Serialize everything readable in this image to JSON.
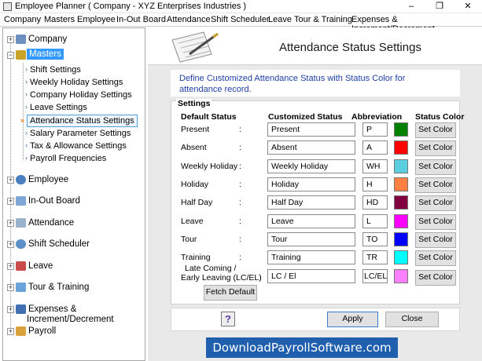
{
  "window": {
    "title": "Employee Planner ( Company - XYZ Enterprises Industries )",
    "minimize": "–",
    "restore": "❐",
    "close": "✕"
  },
  "menu": [
    "Company",
    "Masters",
    "Employee",
    "In-Out Board",
    "Attendance",
    "Shift Scheduler",
    "Leave",
    "Tour & Training",
    "Expenses & Increment/Decrement"
  ],
  "tree": {
    "company": "Company",
    "masters": "Masters",
    "children": [
      "Shift Settings",
      "Weekly Holiday Settings",
      "Company Holiday Settings",
      "Leave Settings",
      "Attendance Status Settings",
      "Salary Parameter Settings",
      "Tax & Allowance Settings",
      "Payroll Frequencies"
    ],
    "employee": "Employee",
    "inout": "In-Out Board",
    "attendance": "Attendance",
    "shift": "Shift Scheduler",
    "leave": "Leave",
    "tour": "Tour & Training",
    "expenses_line1": "Expenses &",
    "expenses_line2": "Increment/Decrement",
    "payroll": "Payroll"
  },
  "header": {
    "title": "Attendance Status Settings"
  },
  "description": "Define Customized Attendance Status with Status Color for attendance record.",
  "settings": {
    "legend": "Settings",
    "col_default": "Default Status",
    "col_custom": "Customized Status",
    "col_abbr": "Abbreviation",
    "col_color": "Status Color",
    "set_color_label": "Set Color",
    "rows": [
      {
        "default": "Present",
        "custom": "Present",
        "abbr": "P",
        "color": "#008000"
      },
      {
        "default": "Absent",
        "custom": "Absent",
        "abbr": "A",
        "color": "#ff0000"
      },
      {
        "default": "Weekly Holiday",
        "custom": "Weekly Holiday",
        "abbr": "WH",
        "color": "#5bcfe0"
      },
      {
        "default": "Holiday",
        "custom": "Holiday",
        "abbr": "H",
        "color": "#ff8040"
      },
      {
        "default": "Half Day",
        "custom": "Half Day",
        "abbr": "HD",
        "color": "#800040"
      },
      {
        "default": "Leave",
        "custom": "Leave",
        "abbr": "L",
        "color": "#ff00ff"
      },
      {
        "default": "Tour",
        "custom": "Tour",
        "abbr": "TO",
        "color": "#0000ff"
      },
      {
        "default": "Training",
        "custom": "Training",
        "abbr": "TR",
        "color": "#00ffff"
      },
      {
        "default_line1": "Late Coming /",
        "default_line2": "Early Leaving (LC/EL)",
        "custom": "LC / El",
        "abbr": "LC/EL",
        "color": "#ff80ff"
      }
    ],
    "fetch_default": "Fetch Default"
  },
  "footer": {
    "help": "?",
    "apply": "Apply",
    "close": "Close"
  },
  "watermark": "DownloadPayrollSoftware.com"
}
